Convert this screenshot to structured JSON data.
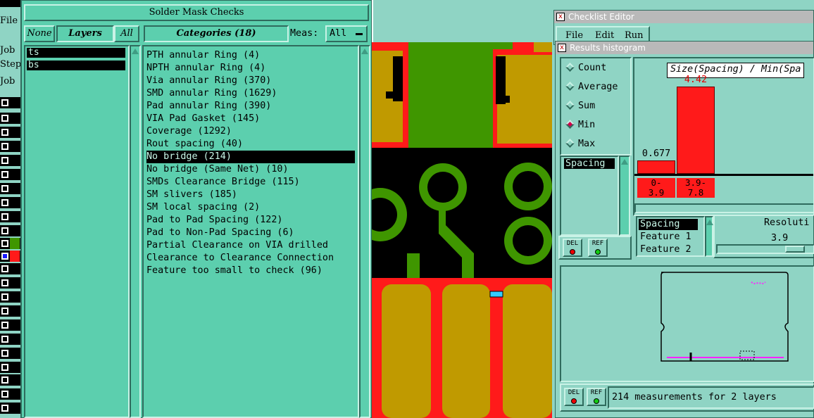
{
  "left_strip": {
    "labels": [
      "File",
      "Job",
      "Step",
      "Job"
    ]
  },
  "solder_mask": {
    "title": "Solder Mask Checks",
    "none_label": "None",
    "layers_label": "Layers",
    "all_label": "All",
    "categories_label": "Categories (18)",
    "meas_label": "Meas:",
    "meas_value": "All",
    "layers": [
      "ts",
      "bs"
    ],
    "categories": [
      "PTH annular Ring (4)",
      "NPTH annular Ring (4)",
      "Via annular Ring (370)",
      "SMD annular Ring (1629)",
      "Pad annular Ring (390)",
      "VIA Pad Gasket (145)",
      "Coverage (1292)",
      "Rout spacing (40)",
      "No bridge (214)",
      "No bridge (Same Net) (10)",
      "SMDs Clearance Bridge (115)",
      "SM slivers (185)",
      "SM local spacing (2)",
      "Pad to Pad Spacing (122)",
      "Pad to Non-Pad Spacing (6)",
      "Partial Clearance on VIA drilled",
      "Clearance to Clearance Connection",
      "Feature too small to check (96)"
    ],
    "selected_category": "No bridge (214)"
  },
  "checklist_editor": {
    "title": "Checklist Editor",
    "menu": [
      "File",
      "Edit",
      "Run"
    ]
  },
  "histogram": {
    "title": "Results histogram",
    "modes": [
      "Count",
      "Average",
      "Sum",
      "Min",
      "Max"
    ],
    "selected_mode": "Min",
    "list_items": [
      "Spacing"
    ],
    "chart_title": "Size(Spacing) / Min(Spa",
    "del_label": "DEL",
    "ref_label": "REF",
    "field_list": [
      "Spacing",
      "Feature 1",
      "Feature 2"
    ],
    "resolution_label": "Resoluti",
    "resolution_value": "3.9",
    "status": "214 measurements for 2 layers"
  },
  "chart_data": {
    "type": "bar",
    "title": "Size(Spacing) / Min(Spa",
    "categories": [
      "0-3.9",
      "3.9-7.8"
    ],
    "values": [
      0.677,
      4.42
    ],
    "value_labels": [
      "0.677",
      "4.42"
    ],
    "bin_labels": [
      [
        "0-",
        "3.9"
      ],
      [
        "3.9-",
        "7.8"
      ]
    ],
    "ylim": [
      0,
      4.42
    ],
    "colors": {
      "bar": "#ff1a1a"
    }
  },
  "colors": {
    "panel_bg": "#5ccfae",
    "window_bg": "#8fd4c4",
    "pcb_green": "#3f9600",
    "pcb_gold": "#c09a00",
    "pcb_red": "#ff1a1a",
    "marker_cyan": "#33ccff"
  }
}
